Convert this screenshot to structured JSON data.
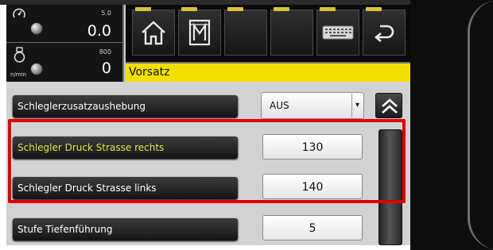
{
  "status": {
    "row1": {
      "max": "5.0",
      "value": "0.0",
      "icon": "speedometer-icon"
    },
    "row2": {
      "max": "800",
      "value": "0",
      "unit": "n/min",
      "icon": "rpm-icon"
    }
  },
  "toolbar": {
    "buttons": [
      {
        "icon": "home-icon"
      },
      {
        "icon": "machine-icon"
      },
      {
        "icon": "blank"
      },
      {
        "icon": "blank"
      },
      {
        "icon": "keyboard-icon"
      },
      {
        "icon": "back-icon"
      }
    ],
    "accent": "#f1df00",
    "title": "Vorsatz"
  },
  "params": [
    {
      "label": "Schleglerzusatzaushebung",
      "value": "AUS",
      "type": "select"
    },
    {
      "label": "Schlegler Druck Strasse rechts",
      "value": "130",
      "active": true
    },
    {
      "label": "Schlegler Druck Strasse links",
      "value": "140"
    },
    {
      "label": "Stufe Tiefenführung",
      "value": "5"
    }
  ],
  "colors": {
    "highlight": "#e00000",
    "active_label": "#e8e04a"
  }
}
